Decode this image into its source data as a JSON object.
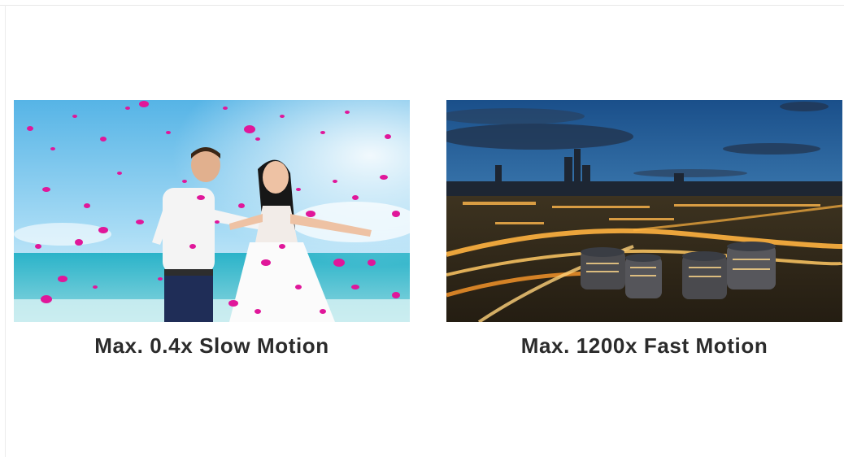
{
  "panels": [
    {
      "caption": "Max. 0.4x Slow Motion"
    },
    {
      "caption": "Max. 1200x Fast Motion"
    }
  ]
}
